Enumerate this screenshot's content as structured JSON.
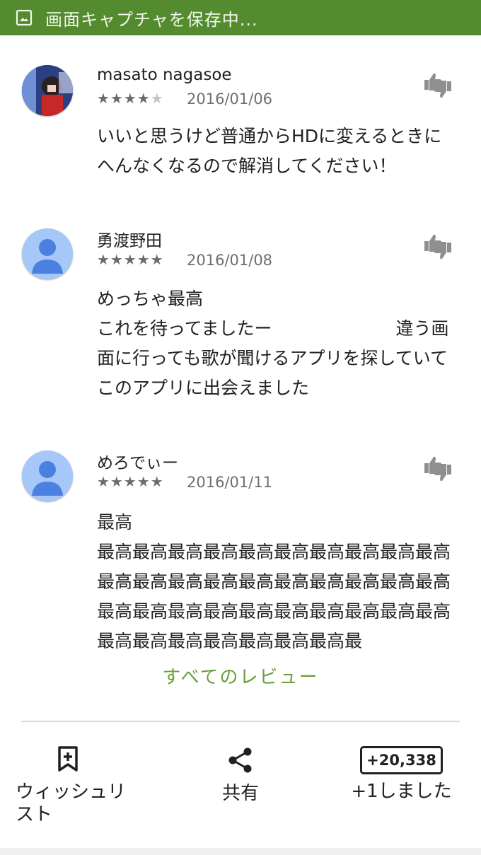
{
  "status_bar": {
    "text": "画面キャプチャを保存中...",
    "icon": "image-icon",
    "color": "#558b2f"
  },
  "reviews": [
    {
      "author": "masato nagasoe",
      "rating": 4,
      "max_rating": 5,
      "date": "2016/01/06",
      "text": "いいと思うけど普通からHDに変えるときにへんなくなるので解消してください！",
      "avatar": "photo"
    },
    {
      "author": "勇渡野田",
      "rating": 5,
      "max_rating": 5,
      "date": "2016/01/08",
      "text": "めっちゃ最高\nこれを待ってましたー　　　　　　　違う画面に行っても歌が聞けるアプリを探していてこのアプリに出会えました",
      "avatar": "default"
    },
    {
      "author": "めろでぃー",
      "rating": 5,
      "max_rating": 5,
      "date": "2016/01/11",
      "text": "最高\n最高最高最高最高最高最高最高最高最高最高最高最高最高最高最高最高最高最高最高最高最高最高最高最高最高最高最高最高最高最高最高最高最高最高最高最高最高最",
      "avatar": "default"
    }
  ],
  "all_reviews_label": "すべてのレビュー",
  "actions": {
    "wishlist_label": "ウィッシュリスト",
    "share_label": "共有",
    "plus_one_count": "+20,338",
    "plus_one_label": "+1しました"
  },
  "colors": {
    "accent": "#689f38",
    "star": "#6b6b6b",
    "avatar_default": "#a5c8f8",
    "avatar_person": "#4a80e0"
  }
}
